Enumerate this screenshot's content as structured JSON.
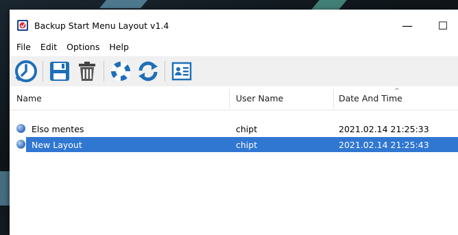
{
  "window": {
    "title": "Backup Start Menu Layout v1.4",
    "minimize_glyph": "—",
    "maximize_glyph": "☐"
  },
  "menu": [
    "File",
    "Edit",
    "Options",
    "Help"
  ],
  "toolbar": {
    "buttons": [
      "backup-clock-icon",
      "save-icon",
      "trash-icon",
      "lifebuoy-icon",
      "refresh-icon",
      "contact-card-icon"
    ]
  },
  "list": {
    "columns": [
      "Name",
      "User Name",
      "Date And Time"
    ],
    "sort_indicator": "^",
    "rows": [
      {
        "name": "Elso mentes",
        "user": "chipt",
        "datetime": "2021.02.14 21:25:33",
        "selected": false
      },
      {
        "name": "New Layout",
        "user": "chipt",
        "datetime": "2021.02.14 21:25:43",
        "selected": true
      }
    ]
  },
  "colors": {
    "selection": "#3077d2",
    "toolbar_bg": "#f0f0f0",
    "icon_blue": "#1f6fb8"
  }
}
